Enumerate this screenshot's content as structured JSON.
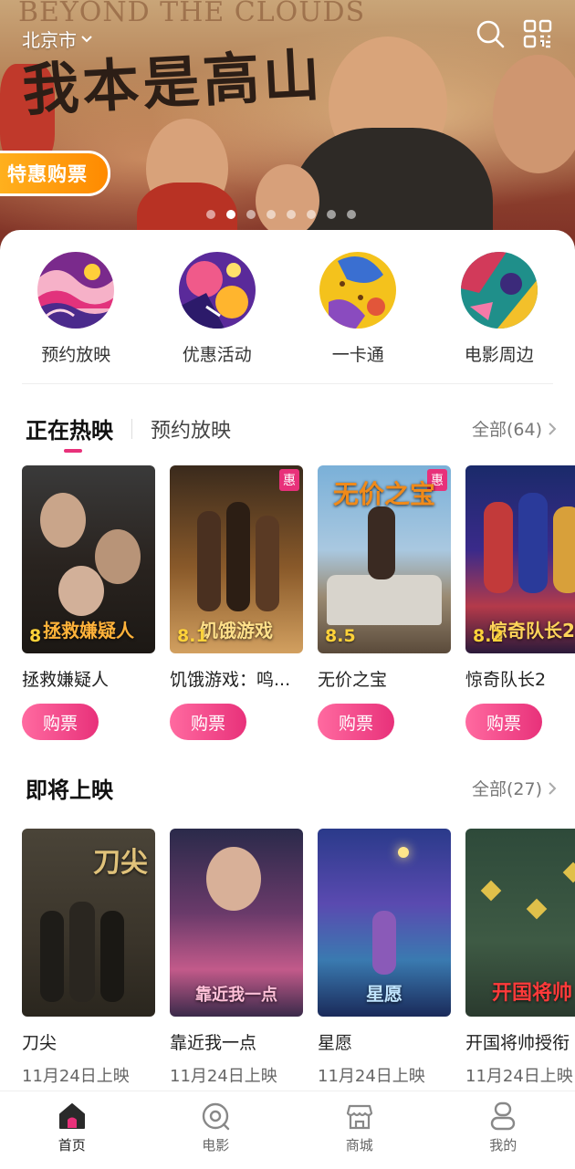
{
  "banner": {
    "english_title": "BEYOND THE CLOUDS",
    "chinese_title": "我本是高山",
    "city": "北京市",
    "promo_tag": "特惠购票",
    "dot_count": 8,
    "active_dot": 1
  },
  "quick_entries": [
    {
      "label": "预约放映",
      "icon": "pattern-pink-wave"
    },
    {
      "label": "优惠活动",
      "icon": "pattern-purple-bloom"
    },
    {
      "label": "一卡通",
      "icon": "pattern-yellow-dots"
    },
    {
      "label": "电影周边",
      "icon": "pattern-teal-red"
    }
  ],
  "now_showing": {
    "tab_active": "正在热映",
    "tab_other": "预约放映",
    "see_all": "全部(64)",
    "buy_label": "购票",
    "movies": [
      {
        "name": "拯救嫌疑人",
        "score": "8",
        "poster_title": "拯救嫌疑人",
        "badge": ""
      },
      {
        "name": "饥饿游戏：鸣...",
        "score": "8.1",
        "poster_title": "饥饿游戏",
        "badge": "惠"
      },
      {
        "name": "无价之宝",
        "score": "8.5",
        "poster_title": "无价之宝",
        "badge": "惠"
      },
      {
        "name": "惊奇队长2",
        "score": "8.2",
        "poster_title": "惊奇队长2",
        "badge": ""
      }
    ]
  },
  "coming_soon": {
    "title": "即将上映",
    "see_all": "全部(27)",
    "movies": [
      {
        "name": "刀尖",
        "date": "11月24日上映",
        "poster_title": "刀尖"
      },
      {
        "name": "靠近我一点",
        "date": "11月24日上映",
        "poster_title": "靠近我一点"
      },
      {
        "name": "星愿",
        "date": "11月24日上映",
        "poster_title": "星愿"
      },
      {
        "name": "开国将帅授衔",
        "date": "11月24日上映",
        "poster_title": "开国将帅"
      }
    ]
  },
  "tabbar": [
    {
      "label": "首页",
      "icon": "home-icon",
      "active": true
    },
    {
      "label": "电影",
      "icon": "movie-icon",
      "active": false
    },
    {
      "label": "商城",
      "icon": "shop-icon",
      "active": false
    },
    {
      "label": "我的",
      "icon": "profile-icon",
      "active": false
    }
  ],
  "colors": {
    "accent": "#e8317a",
    "promo": "#ff9a10",
    "score": "#ffd23a"
  }
}
